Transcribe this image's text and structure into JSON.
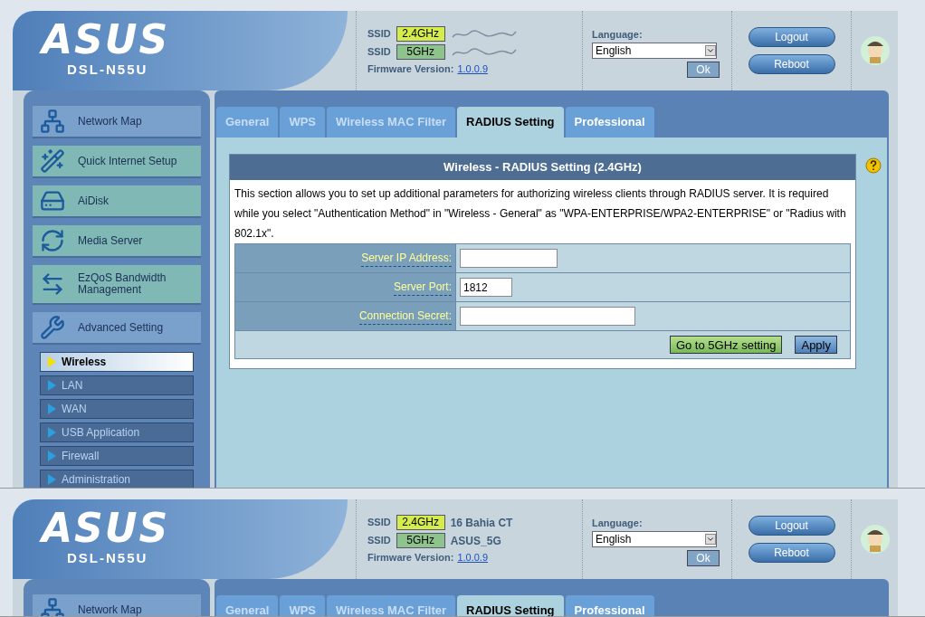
{
  "screens": [
    {
      "logo": "ASUS",
      "model": "DSL-N55U",
      "ssids": [
        {
          "label": "SSID",
          "band": "2.4GHz",
          "color": "#d4ec4c",
          "name_hidden": true
        },
        {
          "label": "SSID",
          "band": "5GHz",
          "color": "#8cc48c",
          "name_hidden": true
        }
      ],
      "firmware": {
        "label": "Firmware Version:",
        "version": "1.0.0.9"
      },
      "language": {
        "label": "Language:",
        "value": "English",
        "ok": "Ok"
      },
      "buttons": [
        "Logout",
        "Reboot"
      ],
      "sidebar": [
        {
          "label": "Network Map",
          "color": "#7aa0cc"
        },
        {
          "label": "Quick Internet Setup",
          "color": "#7fb8b4"
        },
        {
          "label": "AiDisk",
          "color": "#7fb8b4"
        },
        {
          "label": "Media Server",
          "color": "#7fb8b4"
        },
        {
          "label": "EzQoS Bandwidth Management",
          "color": "#7fb8b4"
        },
        {
          "label": "Advanced Setting",
          "color": "#7aa0cc"
        }
      ],
      "submenu": [
        {
          "label": "Wireless",
          "selected": true
        },
        {
          "label": "LAN",
          "selected": false
        },
        {
          "label": "WAN",
          "selected": false
        },
        {
          "label": "USB Application",
          "selected": false
        },
        {
          "label": "Firewall",
          "selected": false
        },
        {
          "label": "Administration",
          "selected": false
        }
      ],
      "tabs": [
        {
          "label": "General",
          "selected": false
        },
        {
          "label": "WPS",
          "selected": false
        },
        {
          "label": "Wireless MAC Filter",
          "selected": false
        },
        {
          "label": "RADIUS Setting",
          "selected": true
        },
        {
          "label": "Professional",
          "selected": false
        }
      ],
      "panel": {
        "title": "Wireless - RADIUS Setting (2.4GHz)",
        "description": "This section allows you to set up additional parameters for authorizing wireless clients through RADIUS server. It is required while you select \"Authentication Method\" in \"Wireless - General\" as \"WPA-ENTERPRISE/WPA2-ENTERPRISE\" or \"Radius with 802.1x\".",
        "fields": [
          {
            "label": "Server IP Address:"
          },
          {
            "label": "Server Port:",
            "value": "1812"
          },
          {
            "label": "Connection Secret:"
          }
        ],
        "buttons": [
          "Go to 5GHz setting",
          "Apply"
        ]
      }
    },
    {
      "logo": "ASUS",
      "model": "DSL-N55U",
      "ssids": [
        {
          "label": "SSID",
          "band": "2.4GHz",
          "color": "#d4ec4c",
          "name_hidden": false,
          "name": "16 Bahia CT"
        },
        {
          "label": "SSID",
          "band": "5GHz",
          "color": "#8cc48c",
          "name_hidden": false,
          "name": "ASUS_5G"
        }
      ],
      "firmware": {
        "label": "Firmware Version:",
        "version": "1.0.0.9"
      },
      "language": {
        "label": "Language:",
        "value": "English",
        "ok": "Ok"
      },
      "buttons": [
        "Logout",
        "Reboot"
      ],
      "sidebar": [
        {
          "label": "Network Map",
          "color": "#7aa0cc"
        }
      ],
      "tabs": [
        {
          "label": "General",
          "selected": false
        },
        {
          "label": "WPS",
          "selected": false
        },
        {
          "label": "Wireless MAC Filter",
          "selected": false
        },
        {
          "label": "RADIUS Setting",
          "selected": true
        },
        {
          "label": "Professional",
          "selected": false
        }
      ]
    }
  ]
}
